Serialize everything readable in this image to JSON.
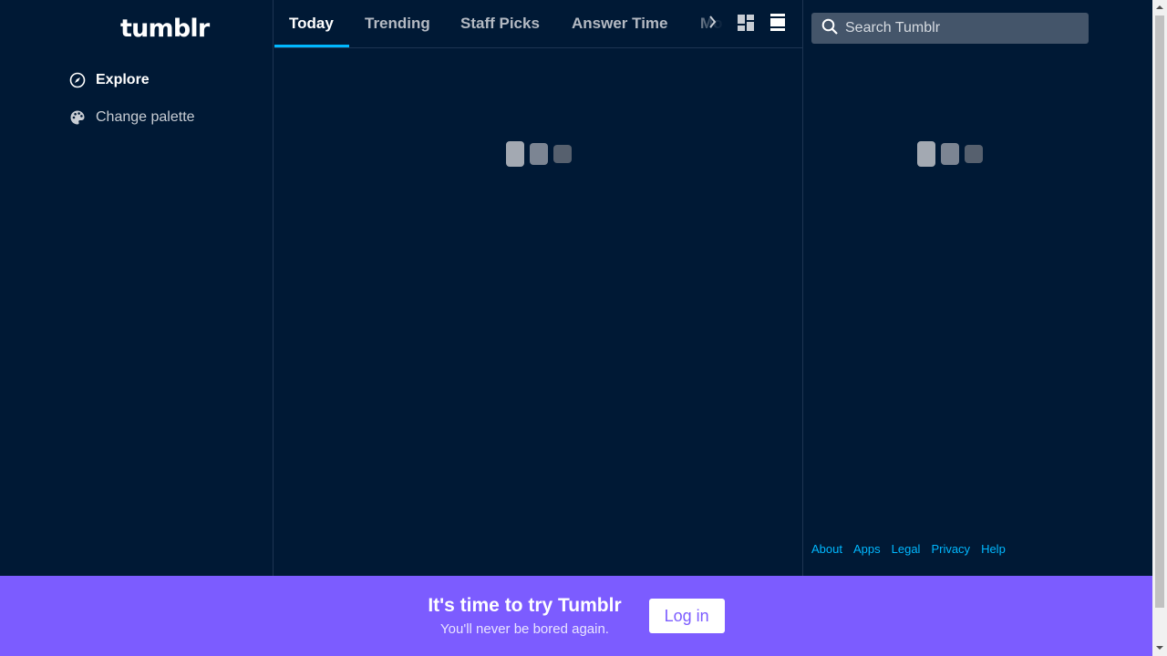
{
  "sidebar": {
    "logo": "tumblr",
    "items": [
      {
        "label": "Explore",
        "icon": "compass-icon"
      },
      {
        "label": "Change palette",
        "icon": "palette-icon"
      }
    ]
  },
  "tabs": {
    "items": [
      {
        "label": "Today",
        "active": true
      },
      {
        "label": "Trending",
        "active": false
      },
      {
        "label": "Staff Picks",
        "active": false
      },
      {
        "label": "Answer Time",
        "active": false
      },
      {
        "label": "Mo",
        "active": false
      }
    ]
  },
  "search": {
    "placeholder": "Search Tumblr"
  },
  "footer": {
    "links": [
      "About",
      "Apps",
      "Legal",
      "Privacy",
      "Help"
    ]
  },
  "banner": {
    "title": "It's time to try Tumblr",
    "subtitle": "You'll never be bored again.",
    "login_label": "Log in"
  },
  "colors": {
    "background": "#001935",
    "accent": "#00b8ff",
    "banner": "#7c5cff"
  }
}
